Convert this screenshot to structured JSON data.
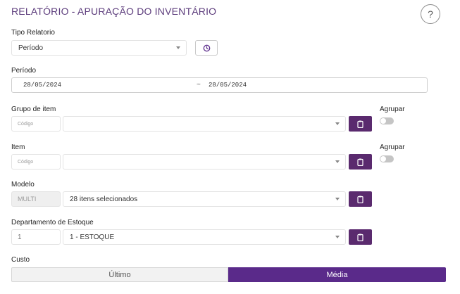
{
  "page": {
    "title": "RELATÓRIO - APURAÇÃO DO INVENTÁRIO",
    "help_label": "?"
  },
  "tipo_relatorio": {
    "label": "Tipo Relatorio",
    "value": "Período"
  },
  "periodo": {
    "label": "Período",
    "start": "28/05/2024",
    "separator": "~",
    "end": "28/05/2024"
  },
  "grupo_item": {
    "label": "Grupo de item",
    "code_placeholder": "Código",
    "value": "",
    "agrupar_label": "Agrupar",
    "agrupar_on": false
  },
  "item": {
    "label": "Item",
    "code_placeholder": "Código",
    "value": "",
    "agrupar_label": "Agrupar",
    "agrupar_on": false
  },
  "modelo": {
    "label": "Modelo",
    "code": "MULTI",
    "value": "28 itens selecionados"
  },
  "departamento": {
    "label": "Departamento de Estoque",
    "code": "1",
    "value": "1 - ESTOQUE"
  },
  "custo": {
    "label": "Custo",
    "options": [
      "Último",
      "Média"
    ],
    "selected": "Média"
  },
  "colors": {
    "accent": "#5a2a8a",
    "button": "#5a2a6e",
    "title": "#5c3c7c"
  },
  "icons": {
    "clock": "clock-icon",
    "clipboard": "clipboard-icon",
    "caret": "chevron-down-icon"
  }
}
